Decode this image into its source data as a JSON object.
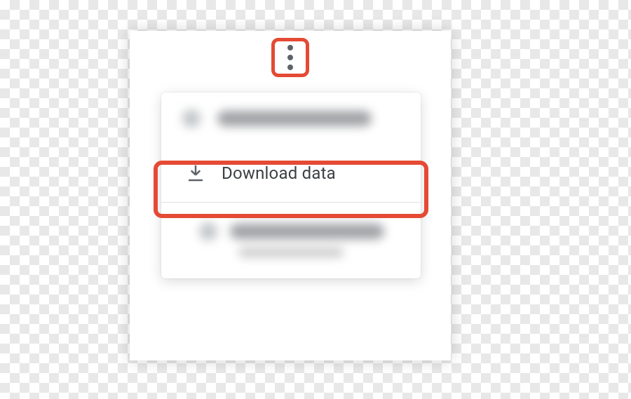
{
  "menu": {
    "download_label": "Download data"
  }
}
